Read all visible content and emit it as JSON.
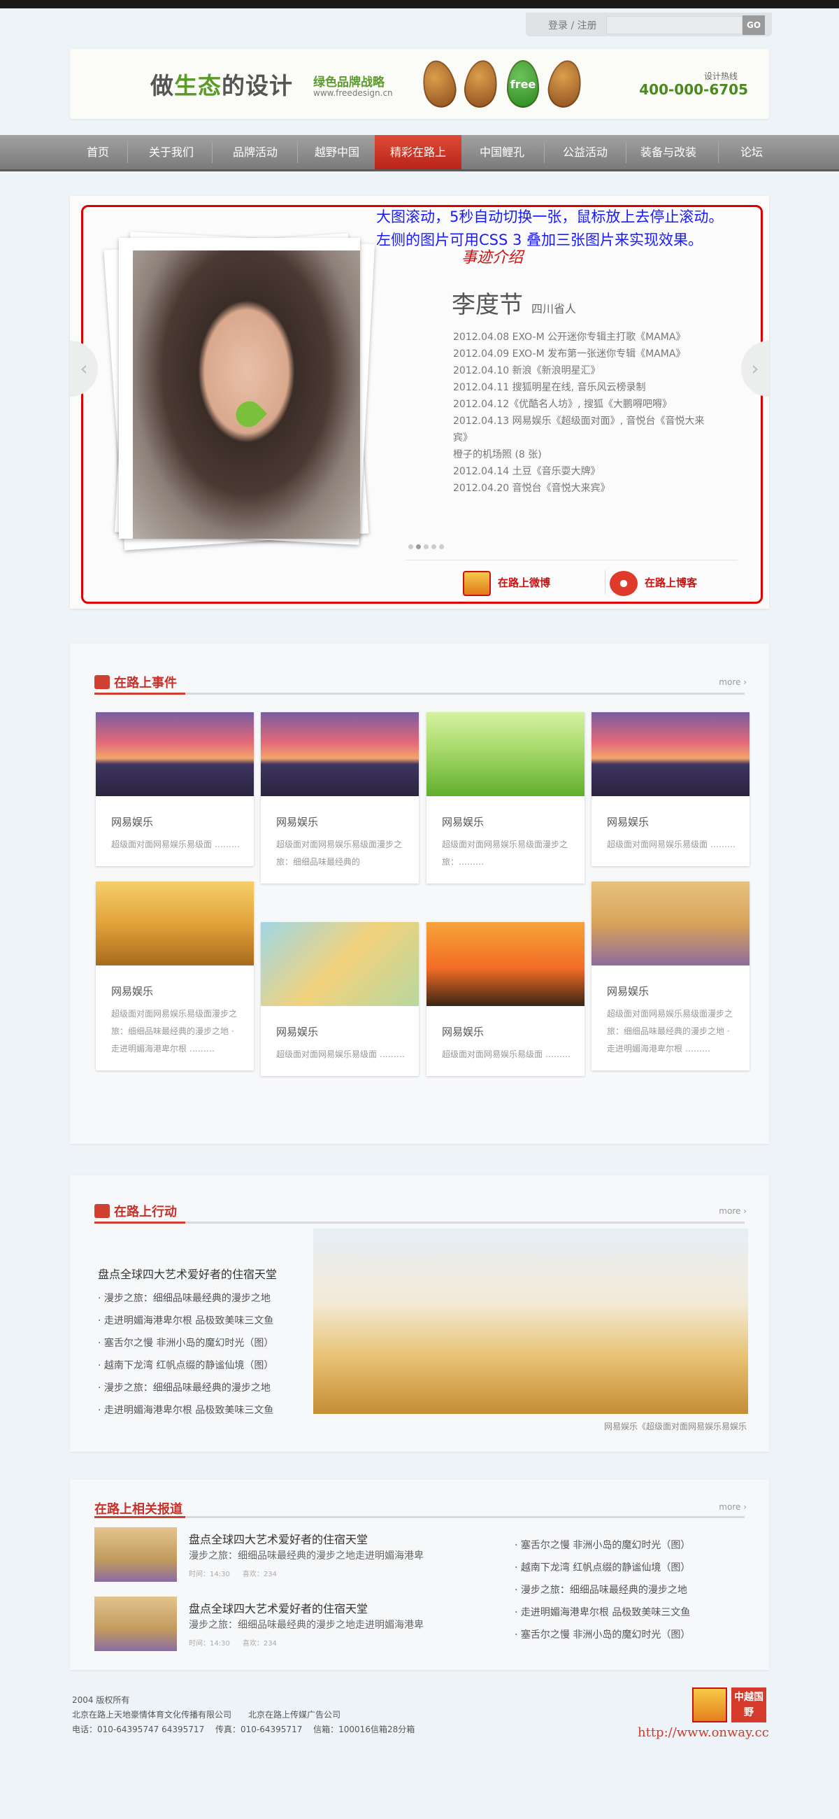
{
  "login": {
    "text": "登录 / 注册",
    "go": "GO",
    "search_placeholder": ""
  },
  "header": {
    "brand_prefix": "做",
    "brand_green": "生态",
    "brand_suffix": "的设计",
    "slogan": "绿色品牌战略",
    "url": "www.freedesign.cn",
    "leaf_label": "free",
    "hotline_label": "设计热线",
    "hotline": "400-000-6705"
  },
  "nav": {
    "items": [
      "首页",
      "关于我们",
      "品牌活动",
      "越野中国",
      "精彩在路上",
      "中国鲤孔",
      "公益活动",
      "装备与改装",
      "论坛"
    ],
    "active": 4
  },
  "slider": {
    "note_line1": "大图滚动，5秒自动切换一张，鼠标放上去停止滚动。",
    "note_line2": "左侧的图片可用CSS 3 叠加三张图片来实现效果。",
    "intro_tag": "事迹介绍",
    "person_name": "李度节",
    "person_origin": "四川省人",
    "events": [
      "2012.04.08 EXO-M 公开迷你专辑主打歌《MAMA》",
      "2012.04.09 EXO-M 发布第一张迷你专辑《MAMA》",
      "2012.04.10 新浪《新浪明星汇》",
      "2012.04.11 搜狐明星在线, 音乐风云榜录制",
      "2012.04.12《优酷名人坊》, 搜狐《大鹏嘚吧嘚》",
      "2012.04.13 网易娱乐《超级面对面》, 音悦台《音悦大来宾》",
      "橙子的机场照 (8 张)",
      "2012.04.14 土豆《音乐耍大牌》",
      "2012.04.20 音悦台《音悦大来宾》"
    ],
    "prev_arrow": "‹",
    "next_arrow": "›",
    "weibo": "在路上微博",
    "blog": "在路上博客"
  },
  "events_section": {
    "title": "在路上事件",
    "more": "more ›",
    "cards": [
      {
        "title": "网易娱乐",
        "desc": "超级面对面网易娱乐易级面 ………"
      },
      {
        "title": "网易娱乐",
        "desc": "超级面对面网易娱乐易级面漫步之旅：细细品味最经典的"
      },
      {
        "title": "网易娱乐",
        "desc": "超级面对面网易娱乐易级面漫步之旅：………"
      },
      {
        "title": "网易娱乐",
        "desc": "超级面对面网易娱乐易级面 ………"
      },
      {
        "title": "网易娱乐",
        "desc": "超级面对面网易娱乐易级面漫步之旅：细细品味最经典的漫步之地 · 走进明媚海港卑尔根 ………"
      },
      {
        "title": "网易娱乐",
        "desc": "超级面对面网易娱乐易级面 ………"
      },
      {
        "title": "网易娱乐",
        "desc": "超级面对面网易娱乐易级面 ………"
      },
      {
        "title": "网易娱乐",
        "desc": "超级面对面网易娱乐易级面漫步之旅：细细品味最经典的漫步之地 · 走进明媚海港卑尔根 ………"
      }
    ]
  },
  "action_section": {
    "title": "在路上行动",
    "more": "more ›",
    "headline": "盘点全球四大艺术爱好者的住宿天堂",
    "items": [
      "· 漫步之旅：细细品味最经典的漫步之地",
      "· 走进明媚海港卑尔根 品极致美味三文鱼",
      "· 塞舌尔之慢 非洲小岛的魔幻时光（图）",
      "· 越南下龙湾 红帆点缀的静谧仙境（图）",
      "· 漫步之旅：细细品味最经典的漫步之地",
      "· 走进明媚海港卑尔根 品极致美味三文鱼"
    ],
    "caption": "网易娱乐《超级面对面网易娱乐易娱乐"
  },
  "report_section": {
    "title": "在路上相关报道",
    "more": "more ›",
    "news": [
      {
        "title": "盘点全球四大艺术爱好者的住宿天堂",
        "desc": "漫步之旅：细细品味最经典的漫步之地走进明媚海港卑",
        "time": "时间：14:30",
        "likes": "喜欢：234"
      },
      {
        "title": "盘点全球四大艺术爱好者的住宿天堂",
        "desc": "漫步之旅：细细品味最经典的漫步之地走进明媚海港卑",
        "time": "时间：14:30",
        "likes": "喜欢：234"
      }
    ],
    "list": [
      "· 塞舌尔之慢 非洲小岛的魔幻时光（图）",
      "· 越南下龙湾 红帆点缀的静谧仙境（图）",
      "· 漫步之旅：细细品味最经典的漫步之地",
      "· 走进明媚海港卑尔根 品极致美味三文鱼",
      "· 塞舌尔之慢 非洲小岛的魔幻时光（图）"
    ]
  },
  "footer": {
    "copyright": "2004 版权所有",
    "companies": "北京在路上天地豪情体育文化传播有限公司　　北京在路上传媒广告公司",
    "contact": "电话：010-64395747 64395717　 传真：010-64395717　 信箱：100016信箱28分箱",
    "logo_text": "中越国野",
    "url": "http://www.onway.cc"
  }
}
